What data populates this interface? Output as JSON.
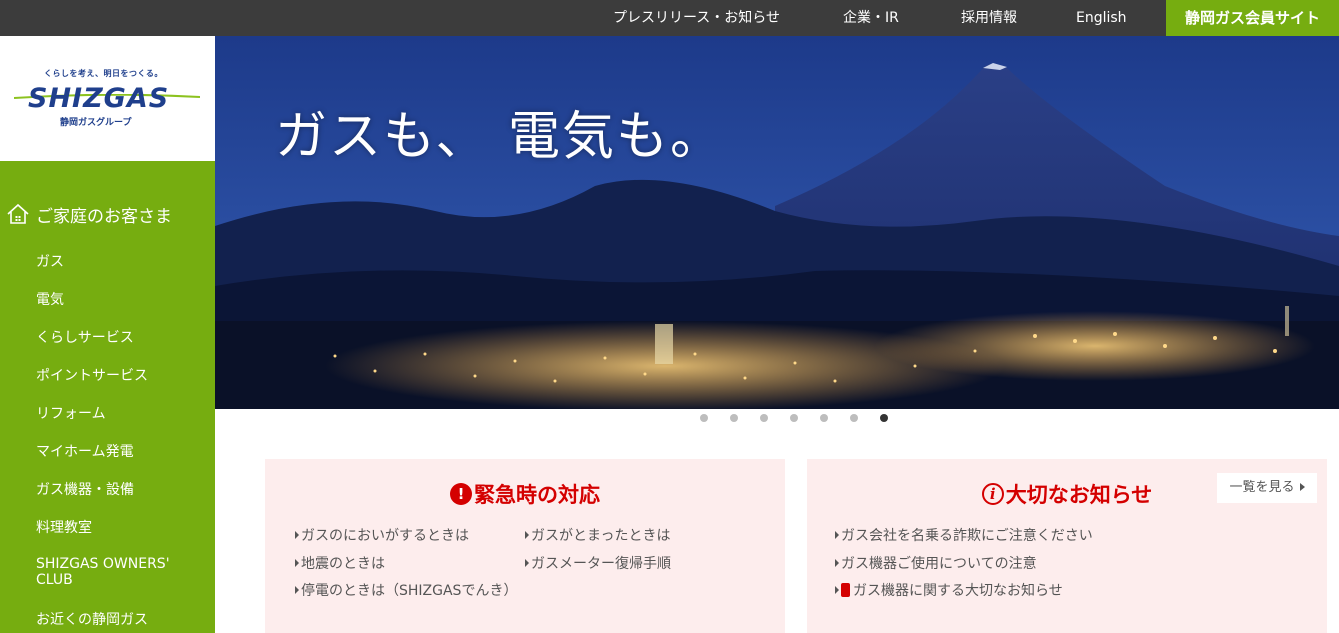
{
  "topnav": {
    "press": "プレスリリース・お知らせ",
    "corporate": "企業・IR",
    "recruit": "採用情報",
    "english": "English",
    "member_site": "静岡ガス会員サイト"
  },
  "logo": {
    "tagline": "くらしを考え、明日をつくる。",
    "brand": "SHIZGAS",
    "group": "静岡ガスグループ"
  },
  "sidebar": {
    "heading": "ご家庭のお客さま",
    "items": [
      {
        "label": "ガス"
      },
      {
        "label": "電気"
      },
      {
        "label": "くらしサービス"
      },
      {
        "label": "ポイントサービス"
      },
      {
        "label": "リフォーム"
      },
      {
        "label": "マイホーム発電"
      },
      {
        "label": "ガス機器・設備"
      },
      {
        "label": "料理教室"
      },
      {
        "label": "SHIZGAS OWNERS' CLUB"
      },
      {
        "label": "お近くの静岡ガス"
      }
    ]
  },
  "hero": {
    "catchcopy": "ガスも、 電気も。",
    "slide_count": 7,
    "active_slide": 7
  },
  "emergency": {
    "title": "緊急時の対応",
    "links": [
      "ガスのにおいがするときは",
      "ガスがとまったときは",
      "地震のときは",
      "ガスメーター復帰手順",
      "停電のときは（SHIZGASでんき）"
    ]
  },
  "notice": {
    "title": "大切なお知らせ",
    "more": "一覧を見る",
    "links": [
      "ガス会社を名乗る詐欺にご注意ください",
      "ガス機器ご使用についての注意",
      "ガス機器に関する大切なお知らせ"
    ]
  },
  "colors": {
    "brand_green": "#76ad10",
    "topbar": "#3c3c3c",
    "brand_navy": "#1f3f8c",
    "alert_red": "#d40000",
    "panel_bg": "#fdeded"
  }
}
